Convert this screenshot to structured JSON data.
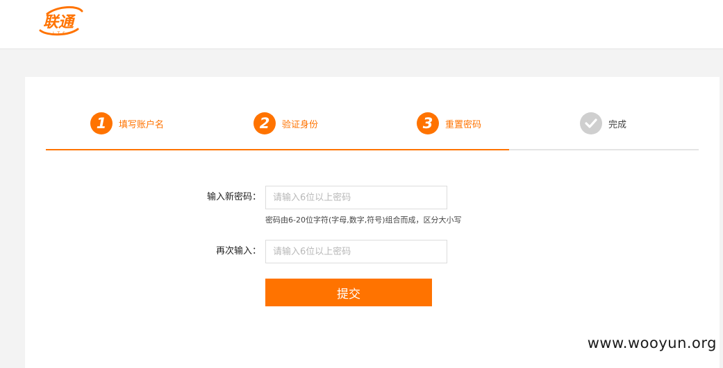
{
  "brand": {
    "logo_text": "联通",
    "logo_sub": "LTS",
    "color": "#ff7300"
  },
  "steps": [
    {
      "number": "1",
      "label": "填写账户名",
      "state": "active"
    },
    {
      "number": "2",
      "label": "验证身份",
      "state": "active"
    },
    {
      "number": "3",
      "label": "重置密码",
      "state": "active"
    },
    {
      "number": "",
      "label": "完成",
      "state": "pending",
      "icon": "check-icon"
    }
  ],
  "progress": {
    "fraction": 0.75
  },
  "form": {
    "new_password": {
      "label": "输入新密码：",
      "placeholder": "请输入6位以上密码",
      "value": "",
      "hint": "密码由6-20位字符(字母,数字,符号)组合而成，区分大小写"
    },
    "confirm_password": {
      "label": "再次输入：",
      "placeholder": "请输入6位以上密码",
      "value": ""
    },
    "submit_label": "提交"
  },
  "watermark": "www.wooyun.org",
  "colors": {
    "accent": "#ff7300",
    "inactive": "#cfcfcf",
    "background": "#f3f3f3"
  }
}
